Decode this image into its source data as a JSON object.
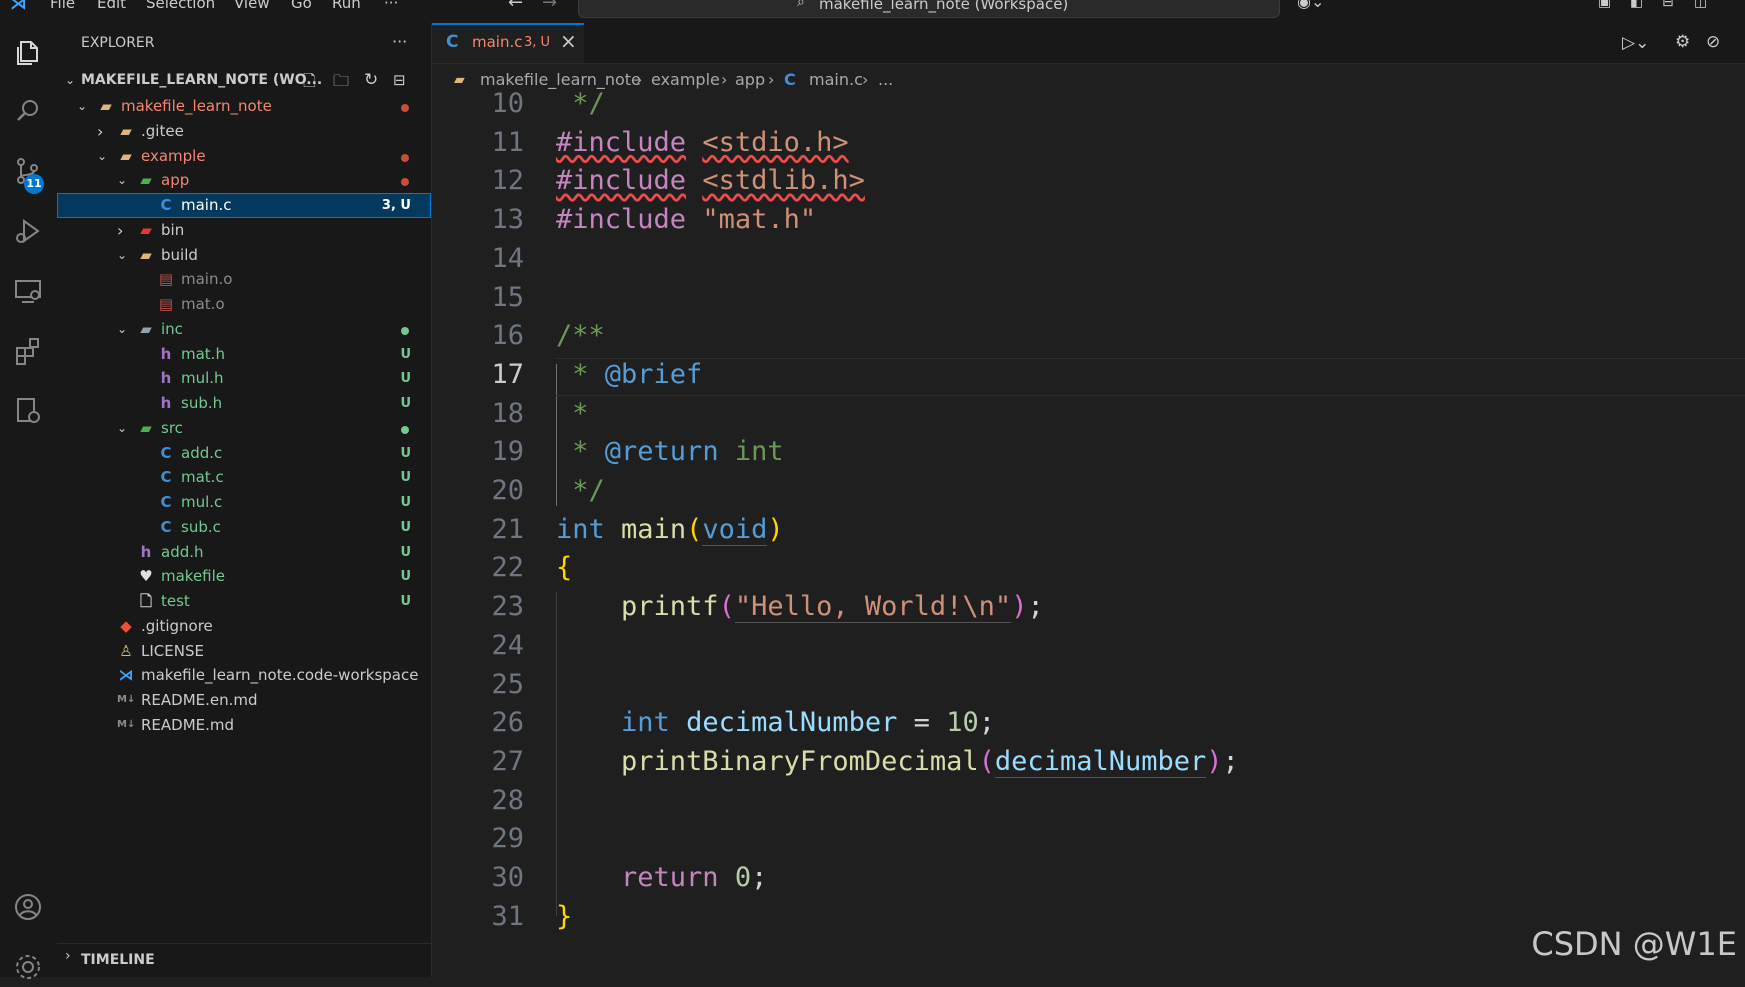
{
  "menu": [
    "File",
    "Edit",
    "Selection",
    "View",
    "Go",
    "Run",
    "···"
  ],
  "command_center": "makefile_learn_note (Workspace)",
  "explorer": {
    "title": "EXPLORER",
    "more": "···",
    "workspace": "MAKEFILE_LEARN_NOTE (WO...",
    "timeline": "TIMELINE"
  },
  "tree": [
    {
      "label": "makefile_learn_note",
      "depth": 1,
      "kind": "folder-open",
      "color": "#f48771",
      "chev": "down",
      "dot": "#c74e39"
    },
    {
      "label": ".gitee",
      "depth": 2,
      "kind": "folder",
      "color": "#cccccc",
      "chev": "right"
    },
    {
      "label": "example",
      "depth": 2,
      "kind": "folder-open",
      "color": "#f48771",
      "chev": "down",
      "dot": "#c74e39"
    },
    {
      "label": "app",
      "depth": 3,
      "kind": "folder-app",
      "color": "#f48771",
      "chev": "down",
      "dot": "#c74e39"
    },
    {
      "label": "main.c",
      "depth": 4,
      "kind": "c",
      "color": "#ffffff",
      "badge": "3, U",
      "badge_color": "#ffffff",
      "selected": true
    },
    {
      "label": "bin",
      "depth": 3,
      "kind": "folder-bin",
      "color": "#cccccc",
      "chev": "right"
    },
    {
      "label": "build",
      "depth": 3,
      "kind": "folder-open",
      "color": "#cccccc",
      "chev": "down"
    },
    {
      "label": "main.o",
      "depth": 4,
      "kind": "obj",
      "color": "#8b8b8b"
    },
    {
      "label": "mat.o",
      "depth": 4,
      "kind": "obj",
      "color": "#8b8b8b"
    },
    {
      "label": "inc",
      "depth": 3,
      "kind": "folder-inc",
      "color": "#73c991",
      "chev": "down",
      "dot": "#73c991"
    },
    {
      "label": "mat.h",
      "depth": 4,
      "kind": "h",
      "color": "#73c991",
      "badge": "U",
      "badge_color": "#73c991"
    },
    {
      "label": "mul.h",
      "depth": 4,
      "kind": "h",
      "color": "#73c991",
      "badge": "U",
      "badge_color": "#73c991"
    },
    {
      "label": "sub.h",
      "depth": 4,
      "kind": "h",
      "color": "#73c991",
      "badge": "U",
      "badge_color": "#73c991"
    },
    {
      "label": "src",
      "depth": 3,
      "kind": "folder-src",
      "color": "#73c991",
      "chev": "down",
      "dot": "#73c991"
    },
    {
      "label": "add.c",
      "depth": 4,
      "kind": "c",
      "color": "#73c991",
      "badge": "U",
      "badge_color": "#73c991"
    },
    {
      "label": "mat.c",
      "depth": 4,
      "kind": "c",
      "color": "#73c991",
      "badge": "U",
      "badge_color": "#73c991"
    },
    {
      "label": "mul.c",
      "depth": 4,
      "kind": "c",
      "color": "#73c991",
      "badge": "U",
      "badge_color": "#73c991"
    },
    {
      "label": "sub.c",
      "depth": 4,
      "kind": "c",
      "color": "#73c991",
      "badge": "U",
      "badge_color": "#73c991"
    },
    {
      "label": "add.h",
      "depth": 3,
      "kind": "h",
      "color": "#73c991",
      "badge": "U",
      "badge_color": "#73c991"
    },
    {
      "label": "makefile",
      "depth": 3,
      "kind": "make",
      "color": "#73c991",
      "badge": "U",
      "badge_color": "#73c991"
    },
    {
      "label": "test",
      "depth": 3,
      "kind": "file",
      "color": "#73c991",
      "badge": "U",
      "badge_color": "#73c991"
    },
    {
      "label": ".gitignore",
      "depth": 2,
      "kind": "git",
      "color": "#cccccc"
    },
    {
      "label": "LICENSE",
      "depth": 2,
      "kind": "license",
      "color": "#cccccc"
    },
    {
      "label": "makefile_learn_note.code-workspace",
      "depth": 2,
      "kind": "vscode",
      "color": "#cccccc"
    },
    {
      "label": "README.en.md",
      "depth": 2,
      "kind": "md",
      "color": "#cccccc"
    },
    {
      "label": "README.md",
      "depth": 2,
      "kind": "md",
      "color": "#cccccc"
    }
  ],
  "tab": {
    "label": "main.c",
    "status": "3, U",
    "close": "×"
  },
  "breadcrumb": [
    "makefile_learn_note",
    "example",
    "app",
    "main.c",
    "..."
  ],
  "scm_badge": "11",
  "code": [
    {
      "n": "10",
      "t": [
        [
          "cmt",
          " */"
        ]
      ]
    },
    {
      "n": "11",
      "t": [
        [
          "kw-inc squig",
          "#include"
        ],
        [
          "plain",
          " "
        ],
        [
          "str squig",
          "<stdio.h>"
        ]
      ]
    },
    {
      "n": "12",
      "t": [
        [
          "kw-inc squig",
          "#include"
        ],
        [
          "plain",
          " "
        ],
        [
          "str squig",
          "<stdlib.h>"
        ]
      ]
    },
    {
      "n": "13",
      "t": [
        [
          "kw-inc",
          "#include"
        ],
        [
          "plain",
          " "
        ],
        [
          "str",
          "\"mat.h\""
        ]
      ]
    },
    {
      "n": "14",
      "t": []
    },
    {
      "n": "15",
      "t": []
    },
    {
      "n": "16",
      "t": [
        [
          "cmt",
          "/**"
        ]
      ]
    },
    {
      "n": "17",
      "t": [
        [
          "cmt",
          " * "
        ],
        [
          "doc-tag",
          "@brief"
        ]
      ],
      "active": true
    },
    {
      "n": "18",
      "t": [
        [
          "cmt",
          " *"
        ]
      ]
    },
    {
      "n": "19",
      "t": [
        [
          "cmt",
          " * "
        ],
        [
          "doc-tag",
          "@return"
        ],
        [
          "cmt",
          " int"
        ]
      ]
    },
    {
      "n": "20",
      "t": [
        [
          "cmt",
          " */"
        ]
      ]
    },
    {
      "n": "21",
      "t": [
        [
          "type",
          "int"
        ],
        [
          "plain",
          " "
        ],
        [
          "fn",
          "main"
        ],
        [
          "brace",
          "("
        ],
        [
          "type dim-underline",
          "void"
        ],
        [
          "brace",
          ")"
        ]
      ]
    },
    {
      "n": "22",
      "t": [
        [
          "brace",
          "{"
        ]
      ]
    },
    {
      "n": "23",
      "t": [
        [
          "plain",
          "    "
        ],
        [
          "fn",
          "printf"
        ],
        [
          "paren",
          "("
        ],
        [
          "str dim-underline",
          "\"Hello, World!\\n\""
        ],
        [
          "paren",
          ")"
        ],
        [
          "plain",
          ";"
        ]
      ]
    },
    {
      "n": "24",
      "t": []
    },
    {
      "n": "25",
      "t": []
    },
    {
      "n": "26",
      "t": [
        [
          "plain",
          "    "
        ],
        [
          "type",
          "int"
        ],
        [
          "plain",
          " "
        ],
        [
          "var",
          "decimalNumber"
        ],
        [
          "plain",
          " = "
        ],
        [
          "num",
          "10"
        ],
        [
          "plain",
          ";"
        ]
      ]
    },
    {
      "n": "27",
      "t": [
        [
          "plain",
          "    "
        ],
        [
          "fn",
          "printBinaryFromDecimal"
        ],
        [
          "paren",
          "("
        ],
        [
          "var dim-underline",
          "decimalNumber"
        ],
        [
          "paren",
          ")"
        ],
        [
          "plain",
          ";"
        ]
      ]
    },
    {
      "n": "28",
      "t": []
    },
    {
      "n": "29",
      "t": []
    },
    {
      "n": "30",
      "t": [
        [
          "plain",
          "    "
        ],
        [
          "kw-inc",
          "return"
        ],
        [
          "plain",
          " "
        ],
        [
          "num",
          "0"
        ],
        [
          "plain",
          ";"
        ]
      ]
    },
    {
      "n": "31",
      "t": [
        [
          "brace",
          "}"
        ]
      ]
    }
  ],
  "watermark": "CSDN @W1E"
}
